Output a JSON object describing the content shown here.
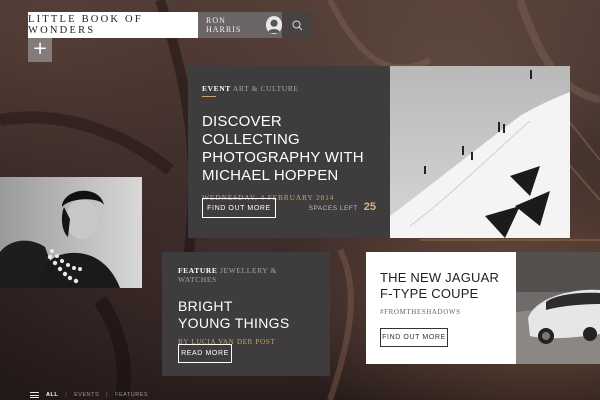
{
  "header": {
    "brand": "LITTLE BOOK OF WONDERS",
    "user_name": "RON HARRIS",
    "search_icon": "search-icon",
    "plus_icon": "plus-icon",
    "plus_glyph": "+"
  },
  "event_card": {
    "category": "EVENT",
    "subcategory": "ART & CULTURE",
    "title_lines": [
      "DISCOVER COLLECTING",
      "PHOTOGRAPHY WITH",
      "MICHAEL HOPPEN"
    ],
    "date": "WEDNESDAY, 4 FEBRUARY 2014",
    "button_label": "FIND OUT MORE",
    "spaces_label": "SPACES LEFT",
    "spaces_value": "25"
  },
  "feature_card": {
    "category": "FEATURE",
    "subcategory": "JEWELLERY & WATCHES",
    "title_lines": [
      "BRIGHT",
      "YOUNG THINGS"
    ],
    "byline": "BY LUCIA VAN DER POST",
    "button_label": "READ MORE"
  },
  "jaguar_card": {
    "title_lines": [
      "THE NEW JAGUAR",
      "F-TYPE COUPE"
    ],
    "hashtag": "#FROMTHESHADOWS",
    "button_label": "FIND OUT MORE"
  },
  "bottom_nav": {
    "menu_icon": "hamburger-menu-icon",
    "items": [
      "ALL",
      "EVENTS",
      "FEATURES"
    ],
    "separator": "|"
  },
  "colors": {
    "accent_gold": "#c9a46a",
    "card_dark": "#3e3c3d",
    "white": "#ffffff"
  }
}
